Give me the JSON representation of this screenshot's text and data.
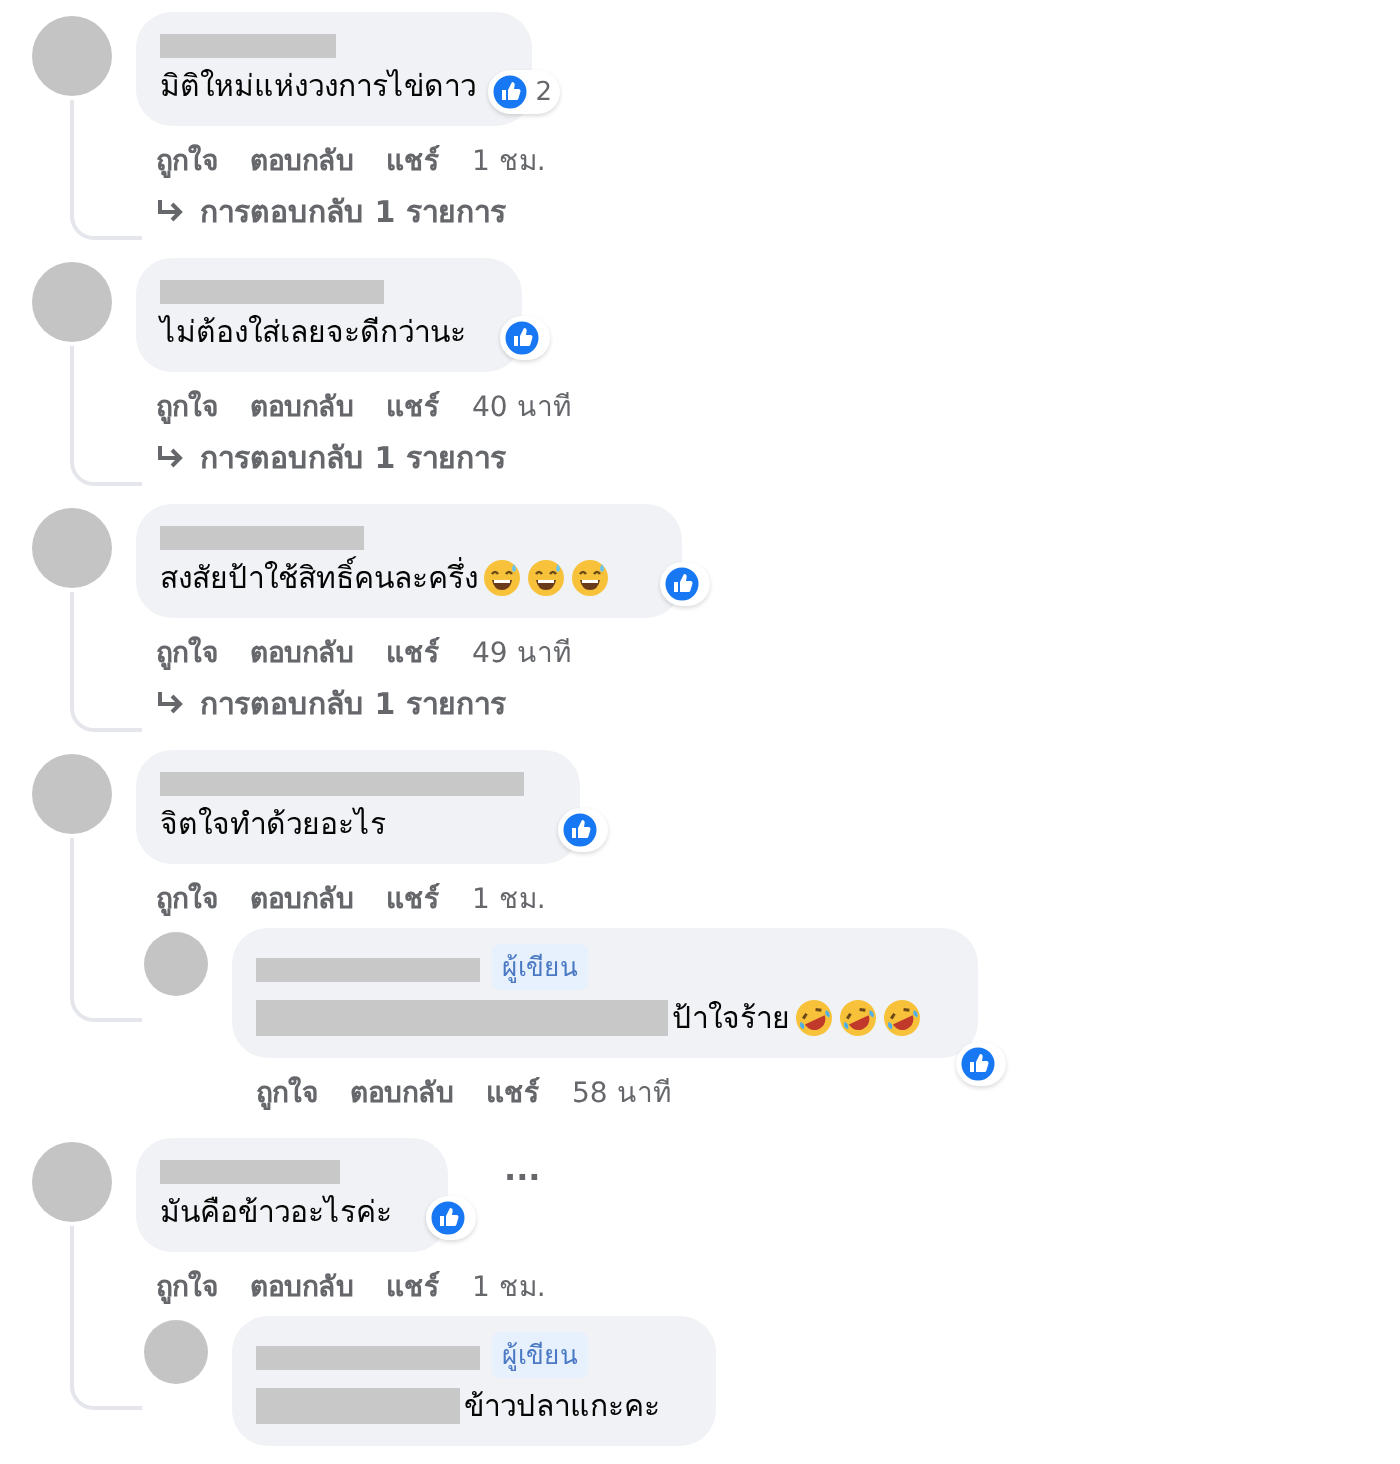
{
  "comments": [
    {
      "text": "มิติใหม่แห่งวงการไข่ดาว",
      "reaction": {
        "liked": true,
        "count": "2"
      },
      "actions": [
        "ถูกใจ",
        "ตอบกลับ",
        "แชร์"
      ],
      "time": "1 ชม.",
      "replies_link": "การตอบกลับ 1 รายการ"
    },
    {
      "text": "ไม่ต้องใส่เลยจะดีกว่านะ",
      "reaction": {
        "liked": true
      },
      "actions": [
        "ถูกใจ",
        "ตอบกลับ",
        "แชร์"
      ],
      "time": "40 นาที",
      "replies_link": "การตอบกลับ 1 รายการ"
    },
    {
      "text": "สงสัยป้าใช้สิทธิ์คนละครึ่ง",
      "emojis": [
        {
          "kind": "sweat-smile"
        },
        {
          "kind": "sweat-smile"
        },
        {
          "kind": "sweat-smile"
        }
      ],
      "reaction": {
        "liked": true
      },
      "actions": [
        "ถูกใจ",
        "ตอบกลับ",
        "แชร์"
      ],
      "time": "49 นาที",
      "replies_link": "การตอบกลับ 1 รายการ"
    },
    {
      "text": "จิตใจทำด้วยอะไร",
      "reaction": {
        "liked": true
      },
      "actions": [
        "ถูกใจ",
        "ตอบกลับ",
        "แชร์"
      ],
      "time": "1 ชม.",
      "replies": [
        {
          "badge": "ผู้เขียน",
          "redacted_prefix": true,
          "text": "ป้าใจร้าย",
          "emojis": [
            {
              "kind": "rofl"
            },
            {
              "kind": "rofl"
            },
            {
              "kind": "rofl"
            }
          ],
          "reaction": {
            "liked": true
          },
          "actions": [
            "ถูกใจ",
            "ตอบกลับ",
            "แชร์"
          ],
          "time": "58 นาที"
        }
      ]
    },
    {
      "text": "มันคือข้าวอะไรค่ะ",
      "reaction": {
        "liked": true
      },
      "menu": "...",
      "actions": [
        "ถูกใจ",
        "ตอบกลับ",
        "แชร์"
      ],
      "time": "1 ชม.",
      "replies": [
        {
          "badge": "ผู้เขียน",
          "redacted_prefix": true,
          "text": "ข้าวปลาแกะคะ"
        }
      ]
    }
  ]
}
